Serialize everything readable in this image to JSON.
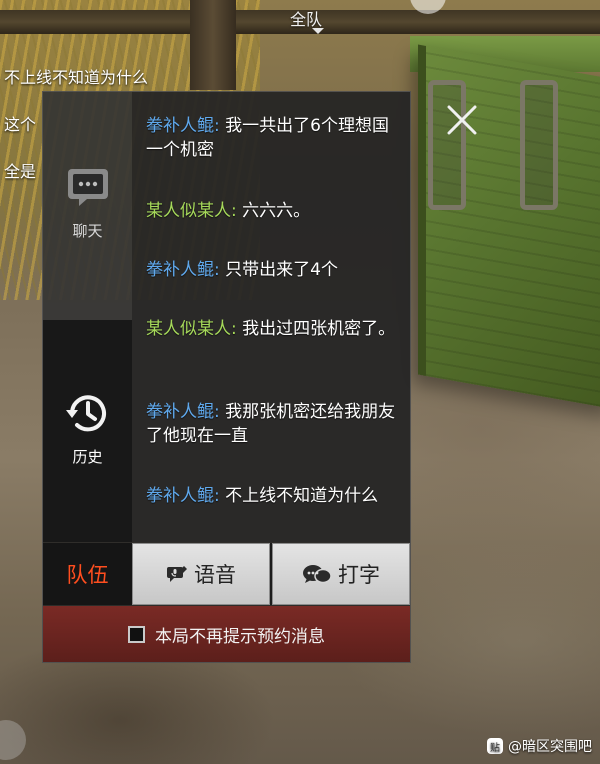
{
  "hud": {
    "team_label": "全队"
  },
  "overlay_messages": [
    "不上线不知道为什么",
    "这个",
    "全是"
  ],
  "sidebar": {
    "tabs": [
      {
        "label": "聊天",
        "icon": "chat-bubble-icon",
        "selected": false
      },
      {
        "label": "历史",
        "icon": "history-clock-icon",
        "selected": true
      }
    ]
  },
  "messages": [
    {
      "sender": "拳补人鲲:",
      "text": "我一共出了6个理想国一个机密",
      "sender_color": "#5fa8ec"
    },
    {
      "sender": "某人似某人:",
      "text": "六六六。",
      "sender_color": "#a6d95a"
    },
    {
      "sender": "拳补人鲲:",
      "text": "只带出来了4个",
      "sender_color": "#5fa8ec"
    },
    {
      "sender": "某人似某人:",
      "text": "我出过四张机密了。",
      "sender_color": "#a6d95a"
    },
    {
      "sender": "拳补人鲲:",
      "text": "我那张机密还给我朋友了他现在一直",
      "sender_color": "#5fa8ec"
    },
    {
      "sender": "拳补人鲲:",
      "text": "不上线不知道为什么",
      "sender_color": "#5fa8ec"
    }
  ],
  "tabbar": {
    "team": "队伍",
    "voice": "语音",
    "type": "打字",
    "team_color": "#ff4e1f"
  },
  "reminder": {
    "label": "本局不再提示预约消息",
    "checked": false
  },
  "watermark": {
    "text": "@暗区突围吧"
  }
}
